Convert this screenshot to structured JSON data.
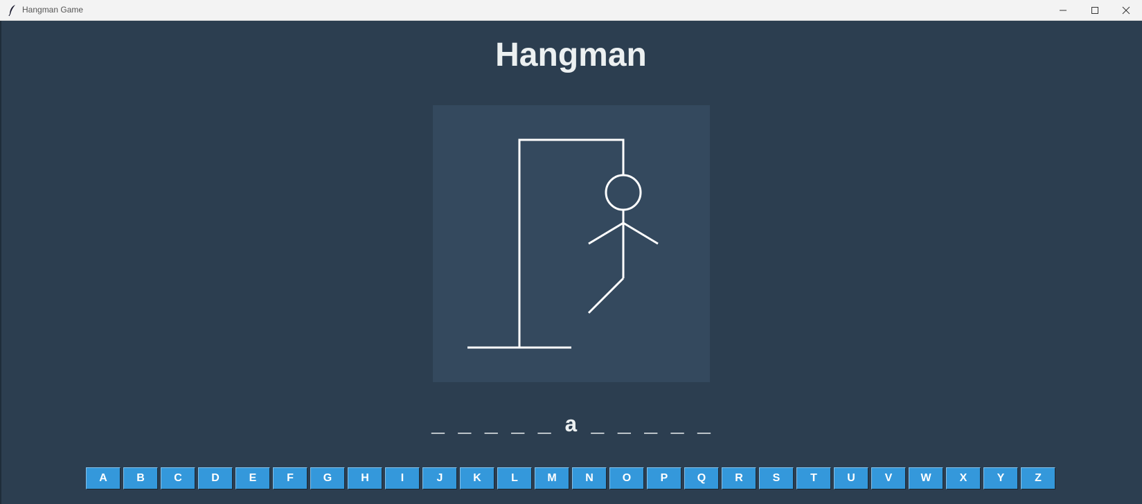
{
  "window": {
    "title": "Hangman Game",
    "app_icon": "feather-icon"
  },
  "window_controls": {
    "minimize": "minimize-icon",
    "maximize": "maximize-icon",
    "close": "close-icon"
  },
  "game": {
    "heading": "Hangman",
    "word_display": "_ _ _ _ _ a _ _ _ _ _",
    "drawn_parts": [
      "gallows",
      "head",
      "body",
      "left-arm",
      "right-arm",
      "left-leg"
    ]
  },
  "keyboard": {
    "letters": [
      "A",
      "B",
      "C",
      "D",
      "E",
      "F",
      "G",
      "H",
      "I",
      "J",
      "K",
      "L",
      "M",
      "N",
      "O",
      "P",
      "Q",
      "R",
      "S",
      "T",
      "U",
      "V",
      "W",
      "X",
      "Y",
      "Z"
    ]
  },
  "colors": {
    "background": "#2c3e50",
    "canvas": "#34495e",
    "key": "#3498db",
    "text": "#ecf0f1"
  }
}
